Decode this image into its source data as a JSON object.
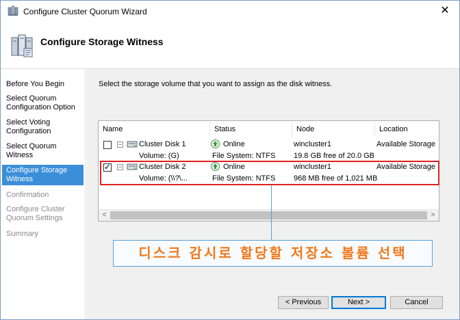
{
  "window": {
    "title": "Configure Cluster Quorum Wizard",
    "close_glyph": "✕"
  },
  "header": {
    "title": "Configure Storage Witness"
  },
  "nav": {
    "items": [
      {
        "label": "Before You Begin",
        "state": "normal"
      },
      {
        "label": "Select Quorum Configuration Option",
        "state": "normal"
      },
      {
        "label": "Select Voting Configuration",
        "state": "normal"
      },
      {
        "label": "Select Quorum Witness",
        "state": "normal"
      },
      {
        "label": "Configure Storage Witness",
        "state": "selected"
      },
      {
        "label": "Confirmation",
        "state": "disabled"
      },
      {
        "label": "Configure Cluster Quorum Settings",
        "state": "disabled"
      },
      {
        "label": "Summary",
        "state": "disabled"
      }
    ]
  },
  "main": {
    "instruction": "Select the storage volume that you want to assign as the disk witness."
  },
  "list": {
    "columns": [
      "Name",
      "Status",
      "Node",
      "Location"
    ],
    "rows": [
      {
        "checked": false,
        "expander": "−",
        "name": "Cluster Disk 1",
        "status": "Online",
        "node": "wincluster1",
        "location": "Available Storage",
        "volume": "Volume: (G)",
        "filesystem": "File System: NTFS",
        "free": "19.8 GB free of 20.0 GB"
      },
      {
        "checked": true,
        "expander": "−",
        "name": "Cluster Disk 2",
        "status": "Online",
        "node": "wincluster1",
        "location": "Available Storage",
        "volume": "Volume: (\\\\?\\...",
        "filesystem": "File System: NTFS",
        "free": "968 MB free of 1,021 MB"
      }
    ],
    "scroll_left": "<",
    "scroll_right": ">"
  },
  "annotation": {
    "text": "디스크 감시로 할당할 저장소 볼륨 선택",
    "text_color": "#f07818",
    "highlight_color": "#e02020"
  },
  "footer": {
    "previous": "< Previous",
    "next": "Next >",
    "cancel": "Cancel"
  },
  "icons": {
    "title": "cluster-icon",
    "header": "server-cluster-icon",
    "disk": "disk-icon",
    "status": "online-arrow-icon"
  }
}
